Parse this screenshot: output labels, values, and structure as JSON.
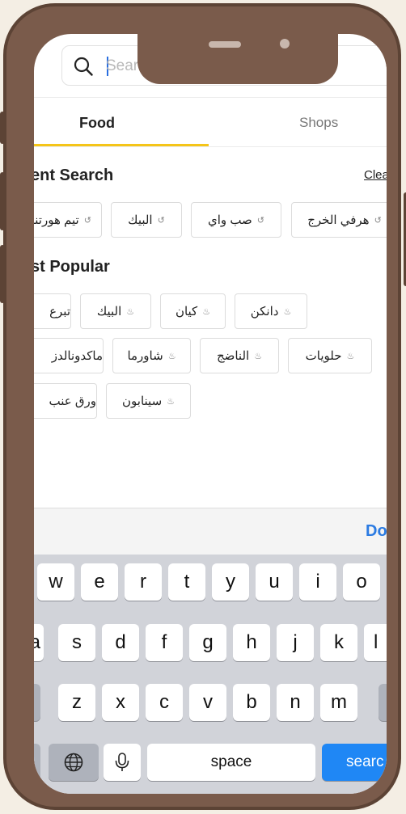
{
  "search": {
    "placeholder": "Search for a Restaurant, or Meal"
  },
  "tabs": [
    {
      "label": "Food",
      "active": true
    },
    {
      "label": "Shops",
      "active": false
    }
  ],
  "recent": {
    "title": "ent Search",
    "clear_label": "Clea",
    "chips": [
      "هرفي الخرج",
      "صب واي",
      "البيك",
      "تيم هورتنز"
    ]
  },
  "popular": {
    "title": "st Popular",
    "row1": [
      "دانكن",
      "كيان",
      "البيك",
      "تبرع"
    ],
    "row2": [
      "حلويات",
      "الناضج",
      "شاورما",
      "ماكدونالدز"
    ],
    "row3": [
      "سينابون",
      "ورق عنب"
    ]
  },
  "keyboard": {
    "done_label": "Do",
    "row1": [
      "w",
      "e",
      "r",
      "t",
      "y",
      "u",
      "i",
      "o"
    ],
    "row2": [
      "a",
      "s",
      "d",
      "f",
      "g",
      "h",
      "j",
      "k",
      "l"
    ],
    "row3": [
      "z",
      "x",
      "c",
      "v",
      "b",
      "n",
      "m"
    ],
    "space_label": "space",
    "search_label": "searc",
    "accent_color": "#1f87f5"
  },
  "colors": {
    "frame": "#7a5b4b",
    "tab_underline": "#f5c518",
    "background": "#f4eee4"
  },
  "icons": {
    "search": "search-icon",
    "history": "history-icon",
    "popular": "fire-icon",
    "globe": "globe-icon",
    "mic": "mic-icon"
  }
}
